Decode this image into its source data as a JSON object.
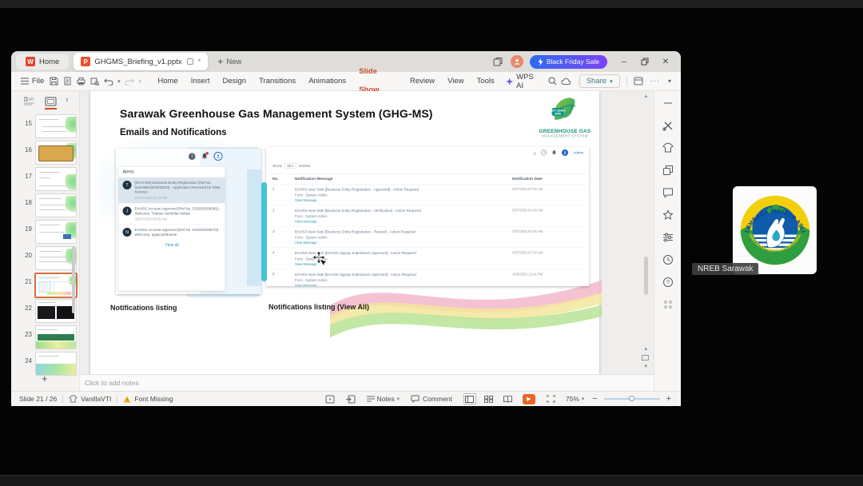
{
  "titlebar": {
    "home_tab": "Home",
    "doc_tab": "GHGMS_Briefing_v1.pptx",
    "new_label": "New",
    "promo": "Black Friday Sale"
  },
  "menubar": {
    "file": "File",
    "items": [
      "Home",
      "Insert",
      "Design",
      "Transitions",
      "Animations",
      "Slide Show",
      "Review",
      "View",
      "Tools"
    ],
    "ai_label": "WPS AI",
    "share_label": "Share"
  },
  "panel": {
    "numbers": [
      "15",
      "16",
      "17",
      "18",
      "19",
      "20",
      "21",
      "22",
      "23",
      "24"
    ],
    "selected": "21"
  },
  "slide": {
    "title": "Sarawak Greenhouse Gas Management System (GHG-MS)",
    "subtitle": "Emails and Notifications",
    "logo": {
      "badge1": "NET ZERO",
      "badge2": "2050",
      "line1": "GREENHOUSE GAS",
      "line2": "MANAGEMENT SYSTEM"
    },
    "alerts": {
      "header": "Alerts",
      "view_all": "View all",
      "items": [
        {
          "initial": "T",
          "text": "[GHG-MS] Business Entity Registration [Ref No. GHG/BE/2025/00033] - Application Received for KNN Surveys",
          "time": "21/10/2025 02:19 PM"
        },
        {
          "initial": "J",
          "text": "EnVISS Account Approved [Ref No. ES/2025/00081] - Welcome, Trainee Sembilan Belas!",
          "time": "30/07/2025 09:09 AM"
        },
        {
          "initial": "N",
          "text": "EnVISS Account Approved [Ref No. ES/2025/00072] - Welcome, applicantfname!",
          "time": ""
        }
      ]
    },
    "listing": {
      "user": "Admin",
      "show_label": "Show",
      "per_page": "10",
      "entries_label": "entries",
      "col_no": "No.",
      "col_msg": "Notification Message",
      "col_date": "Notification Date",
      "from_label": "From : System Admin",
      "view_label": "View Message",
      "rows": [
        {
          "no": "1",
          "msg": "EnVISS New Task [Business Entity Registration - Approved] - Action Required",
          "date": "30/7/2025 07:49 AM"
        },
        {
          "no": "2",
          "msg": "EnVISS New Task [Business Entity Registration - Verification] - Action Required",
          "date": "30/7/2025 07:49 AM"
        },
        {
          "no": "3",
          "msg": "EnVISS New Task [Business Entity Registration - Review] - Action Required",
          "date": "30/7/2025 07:46 AM"
        },
        {
          "no": "4",
          "msg": "EnVISS New Task [EnVISS Signup Submission Approved] - Action Required",
          "date": "30/7/2025 07:39 AM"
        },
        {
          "no": "5",
          "msg": "EnVISS New Task [EnVISS Signup Submission Approved] - Action Required",
          "date": "16/6/2025 12:41 PM"
        }
      ]
    },
    "caption_left": "Notifications listing",
    "caption_right": "Notifications listing (View All)"
  },
  "notes_placeholder": "Click to add notes",
  "statusbar": {
    "slide_info": "Slide 21 / 26",
    "theme_name": "VanillaVTI",
    "warning": "Font Missing",
    "notes_label": "Notes",
    "comment_label": "Comment",
    "zoom_level": "75%"
  },
  "meeting": {
    "participant": "NREB Sarawak",
    "logo_arc_top": "LEMBAGA SUMBER ASLI",
    "logo_arc_bottom": "DAN ALAM SEKITAR SARAWAK"
  },
  "glyphs": {
    "home": "⌂",
    "chevron": "›",
    "plus": "+",
    "close": "✕",
    "minimize": "–",
    "asterisk": "*",
    "caret": "▾",
    "up": "▴",
    "down": "▾",
    "ellipsis": "···",
    "question": "?",
    "info": "i",
    "dash": "—",
    "minus": "−"
  },
  "colors": {
    "accent_orange": "#c8502e",
    "selection_orange": "#d4713a",
    "link_teal": "#2698b5",
    "promo_from": "#2e6bf0",
    "promo_to": "#7b42f6",
    "play_orange": "#e8662d"
  }
}
